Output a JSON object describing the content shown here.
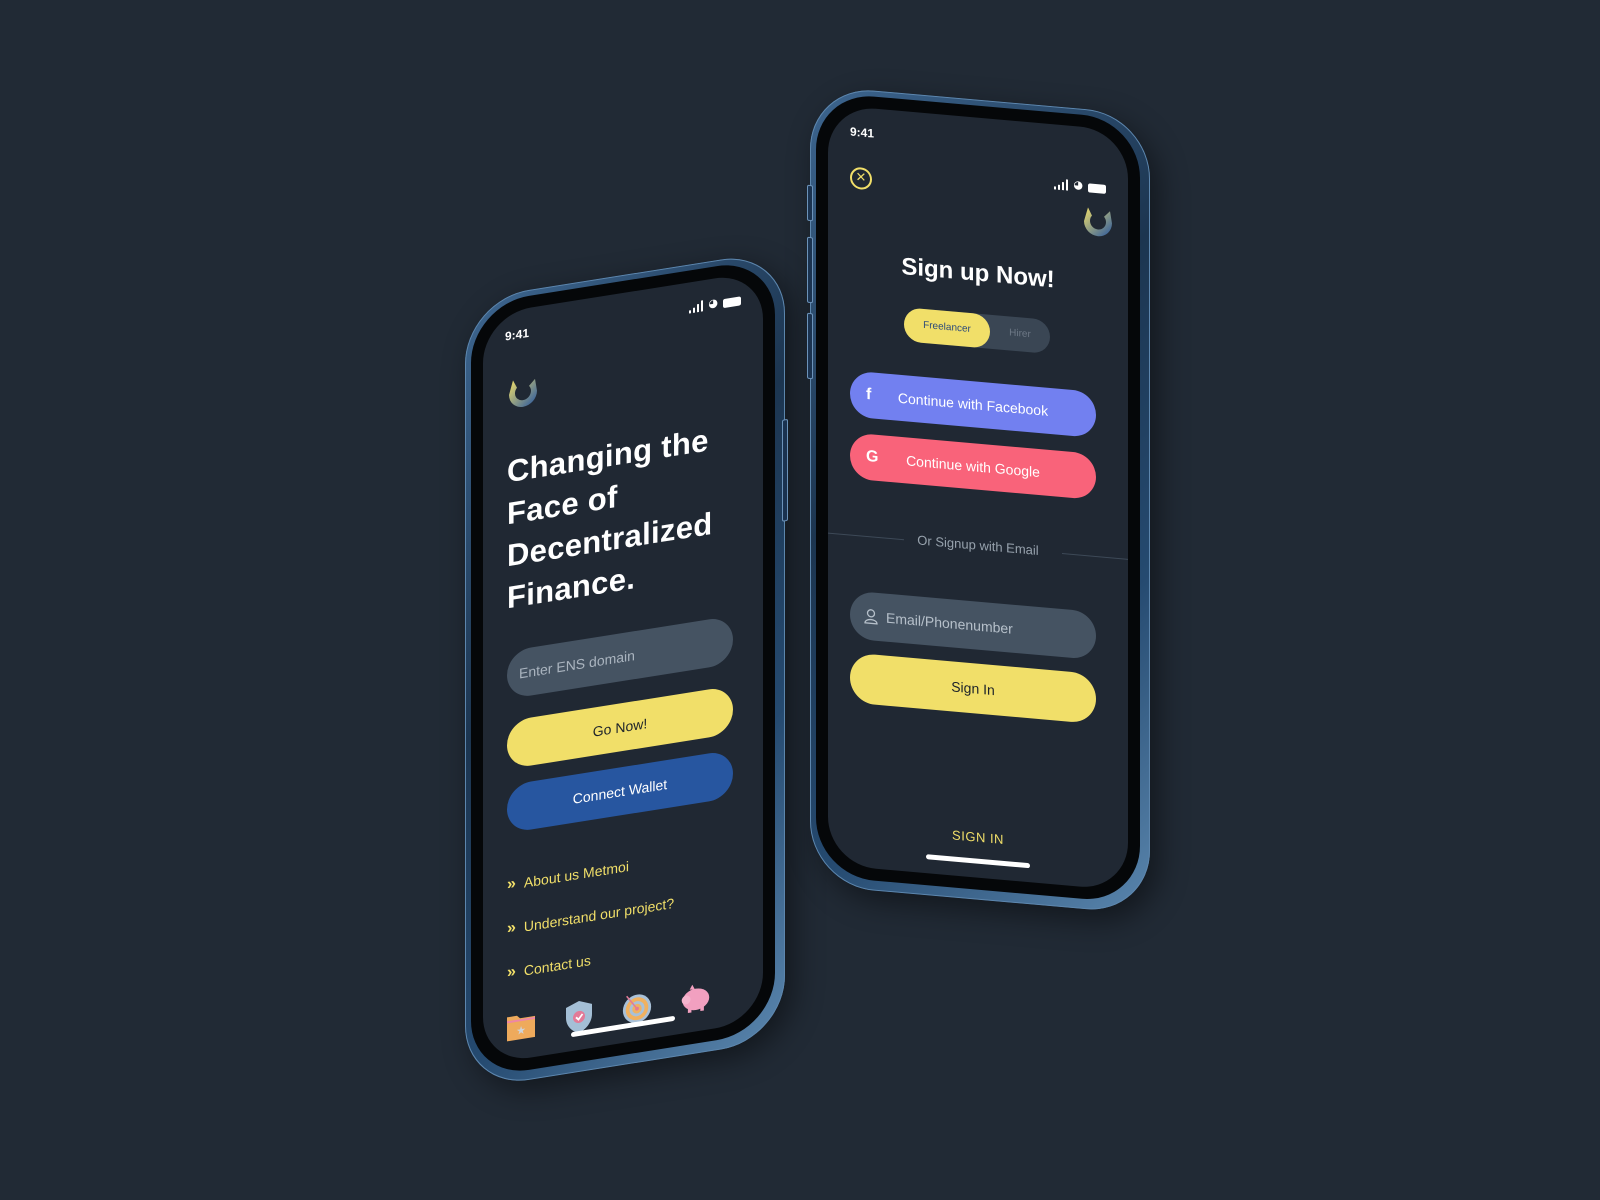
{
  "colors": {
    "background": "#212a35",
    "screen": "#202833",
    "accent_yellow": "#f1df69",
    "wallet_blue": "#2756a0",
    "facebook": "#7280f0",
    "google": "#f9637a",
    "input_bg": "#455362"
  },
  "left_phone": {
    "status_time": "9:41",
    "status_icons": [
      "signal-icon",
      "wifi-icon",
      "battery-icon"
    ],
    "logo": "metmoi-logo",
    "hero_lines": [
      "Changing the",
      "Face of",
      "Decentralized",
      "Finance."
    ],
    "ens_input": {
      "placeholder": "Enter ENS domain",
      "value": ""
    },
    "go_button": "Go Now!",
    "wallet_button": "Connect Wallet",
    "links": [
      {
        "label": "About us Metmoi",
        "icon": "chevron-double-right-icon"
      },
      {
        "label": "Understand our project?",
        "icon": "chevron-double-right-icon"
      },
      {
        "label": "Contact us",
        "icon": "chevron-double-right-icon"
      }
    ],
    "feature_icons": [
      "folder-star-icon",
      "shield-check-icon",
      "target-icon",
      "piggy-bank-icon"
    ]
  },
  "right_phone": {
    "status_time": "9:41",
    "status_icons": [
      "signal-icon",
      "wifi-icon",
      "battery-icon"
    ],
    "close_icon": "close-circle-icon",
    "logo": "metmoi-logo",
    "title": "Sign up Now!",
    "role_toggle": {
      "options": [
        "Freelancer",
        "Hirer"
      ],
      "selected": "Freelancer"
    },
    "facebook_button": {
      "label": "Continue with Facebook",
      "icon_glyph": "f"
    },
    "google_button": {
      "label": "Continue with Google",
      "icon_glyph": "G"
    },
    "divider_text": "Or Signup with Email",
    "email_input": {
      "placeholder": "Email/Phonenumber",
      "value": ""
    },
    "signin_button": "Sign In",
    "signin_link": "SIGN IN"
  }
}
